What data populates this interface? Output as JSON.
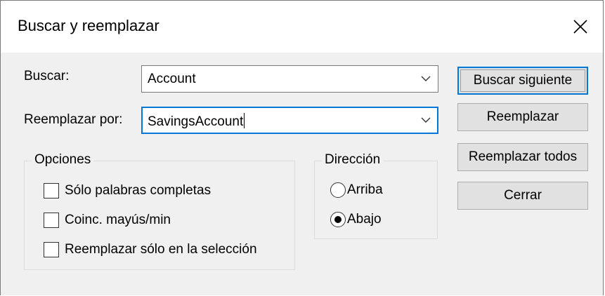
{
  "window": {
    "title": "Buscar y reemplazar",
    "close_icon": "close-icon"
  },
  "find": {
    "label": "Buscar:",
    "value": "Account"
  },
  "replace": {
    "label": "Reemplazar por:",
    "value": "SavingsAccount"
  },
  "options": {
    "legend": "Opciones",
    "items": [
      {
        "label": "Sólo palabras completas",
        "checked": false
      },
      {
        "label": "Coinc. mayús/min",
        "checked": false
      },
      {
        "label": "Reemplazar sólo en la selección",
        "checked": false
      }
    ]
  },
  "direction": {
    "legend": "Dirección",
    "items": [
      {
        "label": "Arriba",
        "selected": false
      },
      {
        "label": "Abajo",
        "selected": true
      }
    ]
  },
  "buttons": {
    "find_next": "Buscar siguiente",
    "replace": "Reemplazar",
    "replace_all": "Reemplazar todos",
    "close": "Cerrar"
  },
  "colors": {
    "accent": "#0078d7",
    "dialog_bg": "#f0f0f0",
    "button_bg": "#e1e1e1"
  }
}
